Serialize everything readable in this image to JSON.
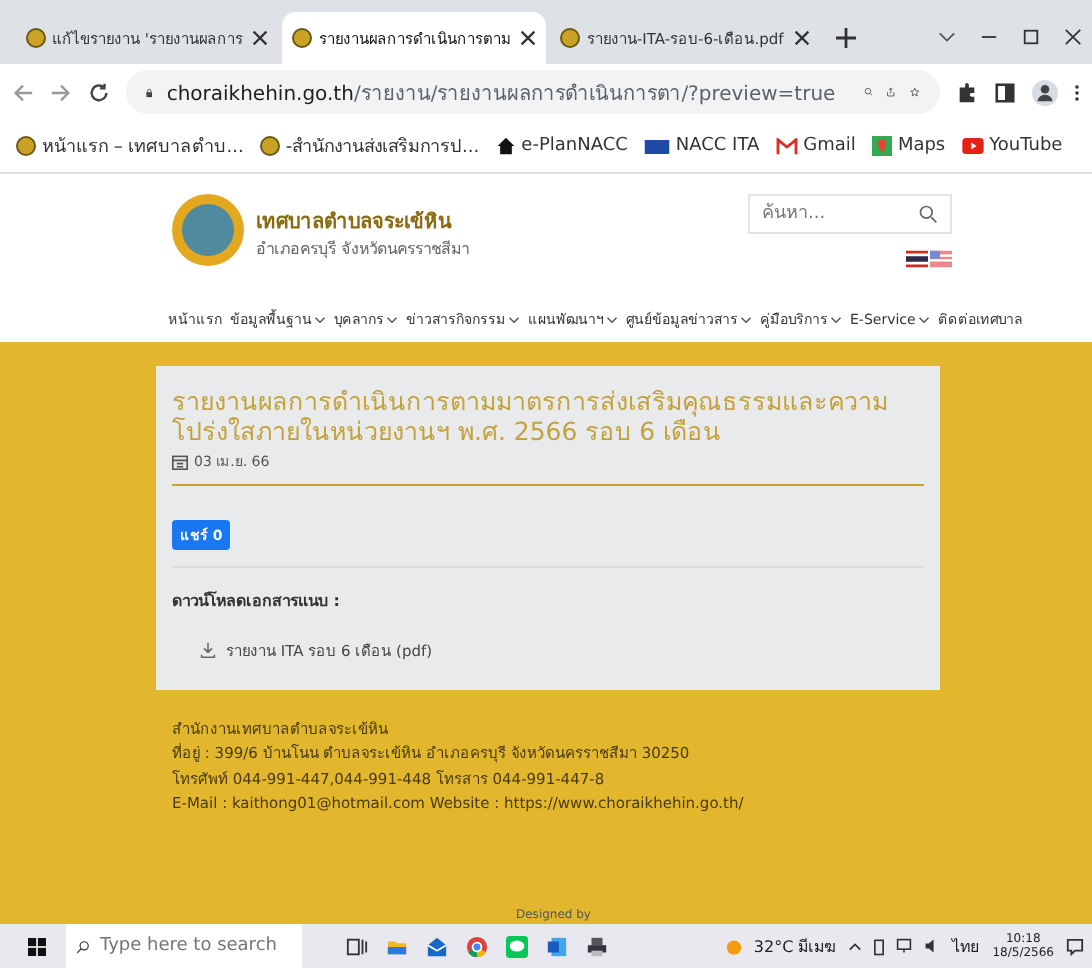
{
  "browser": {
    "tabs": [
      {
        "title": "แก้ไขรายงาน 'รายงานผลการ",
        "selected": false
      },
      {
        "title": "รายงานผลการดำเนินการตาม",
        "selected": true
      },
      {
        "title": "รายงาน-ITA-รอบ-6-เดือน.pdf",
        "selected": false
      }
    ],
    "url_host": "choraikhehin.go.th",
    "url_path": "/รายงาน/รายงานผลการดำเนินการตา/?preview=true",
    "bookmarks": [
      {
        "kind": "seal",
        "label": "หน้าแรก – เทศบาลตำบ..."
      },
      {
        "kind": "seal",
        "label": "-สำนักงานส่งเสริมการป..."
      },
      {
        "kind": "house",
        "label": "e-PlanNACC"
      },
      {
        "kind": "nacc",
        "label": "NACC ITA"
      },
      {
        "kind": "gmail",
        "label": "Gmail"
      },
      {
        "kind": "maps",
        "label": "Maps"
      },
      {
        "kind": "youtube",
        "label": "YouTube"
      }
    ]
  },
  "site": {
    "name": "เทศบาลตำบลจระเข้หิน",
    "subtitle": "อำเภอครบุรี จังหวัดนครราชสีมา",
    "search": {
      "placeholder": "ค้นหา..."
    },
    "nav": [
      {
        "label": "หน้าแรก",
        "dropdown": false
      },
      {
        "label": "ข้อมูลพื้นฐาน",
        "dropdown": true
      },
      {
        "label": "บุคลากร",
        "dropdown": true
      },
      {
        "label": "ข่าวสารกิจกรรม",
        "dropdown": true
      },
      {
        "label": "แผนพัฒนาฯ",
        "dropdown": true
      },
      {
        "label": "ศูนย์ข้อมูลข่าวสาร",
        "dropdown": true
      },
      {
        "label": "คู่มือบริการ",
        "dropdown": true
      },
      {
        "label": "E-Service",
        "dropdown": true
      },
      {
        "label": "ติดต่อเทศบาล",
        "dropdown": false
      }
    ]
  },
  "article": {
    "title": "รายงานผลการดำเนินการตามมาตรการส่งเสริมคุณธรรมและความโปร่งใสภายในหน่วยงานฯ พ.ศ. 2566 รอบ 6 เดือน",
    "date": "03 เม.ย. 66",
    "share": "แชร์ 0",
    "attachments_heading": "ดาวน์โหลดเอกสารแนบ :",
    "attachments": [
      "รายงาน ITA รอบ 6 เดือน (pdf)"
    ]
  },
  "footer": {
    "lines": [
      "สำนักงานเทศบาลตำบลจระเข้หิน",
      "ที่อยู่ : 399/6 บ้านโนน ตำบลจระเข้หิน อำเภอครบุรี จังหวัดนครราชสีมา 30250",
      "โทรศัพท์ 044-991-447,044-991-448 โทรสาร 044-991-447-8",
      "E-Mail : kaithong01@hotmail.com   Website : https://www.choraikhehin.go.th/"
    ],
    "credit": "Designed by"
  },
  "taskbar": {
    "search_placeholder": "Type here to search",
    "weather": "32°C มีเมฆ",
    "language": "ไทย",
    "time": "10:18",
    "date": "18/5/2566"
  }
}
